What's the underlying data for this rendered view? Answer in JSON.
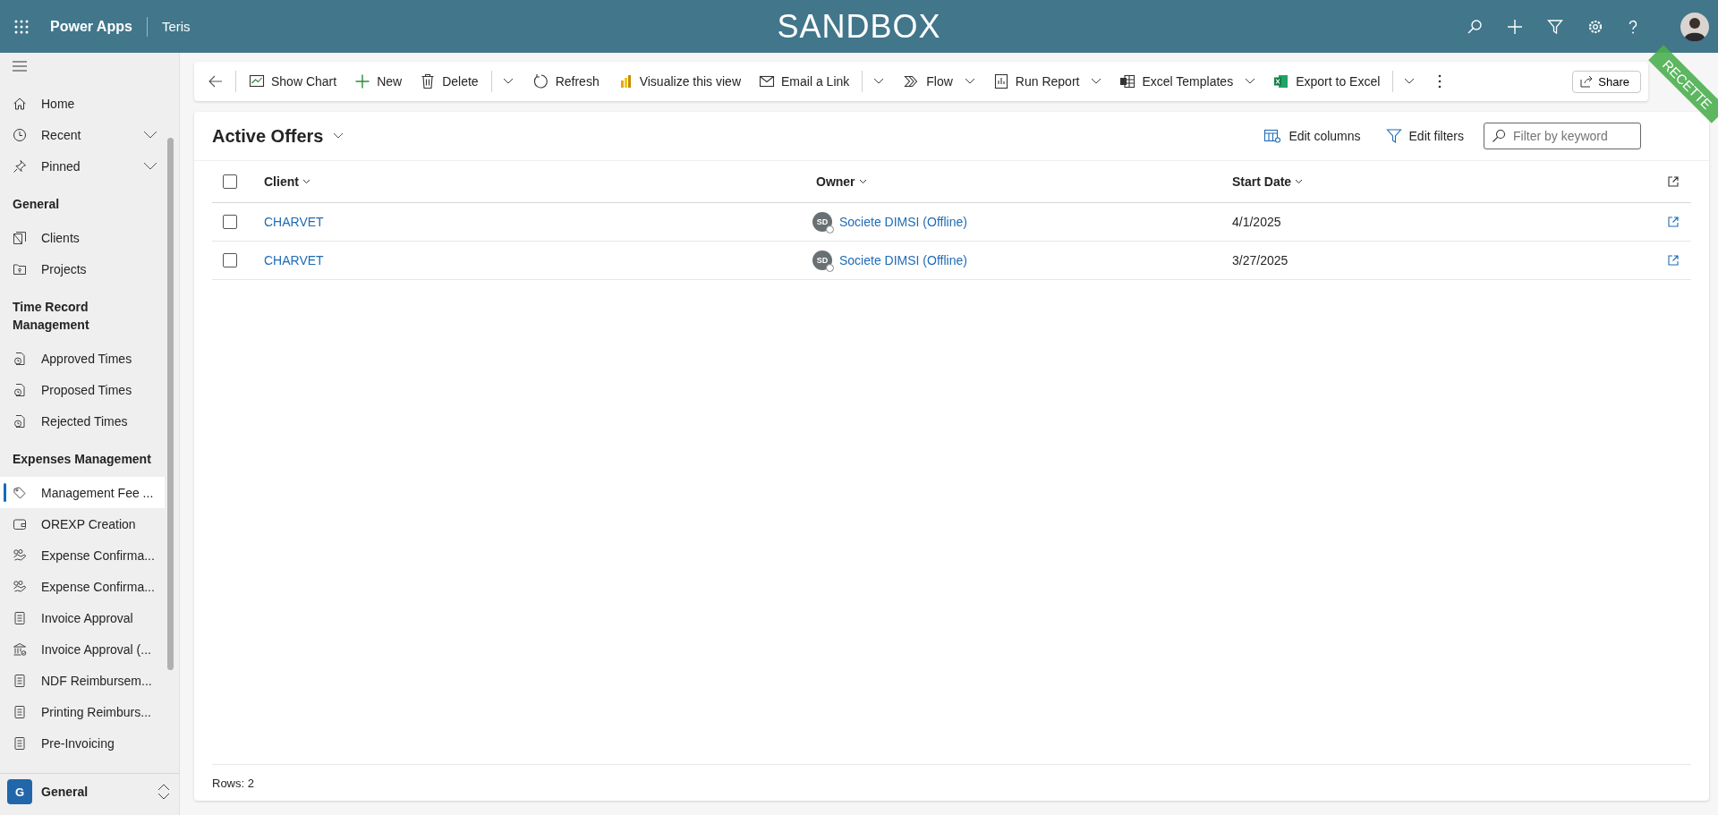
{
  "app": {
    "name": "Power Apps",
    "environment": "Teris",
    "banner": "SANDBOX",
    "ribbon": "RECETTE"
  },
  "sidebar": {
    "top_items": [
      {
        "label": "Home",
        "kind": "home",
        "expandable": false
      },
      {
        "label": "Recent",
        "kind": "clock",
        "expandable": true
      },
      {
        "label": "Pinned",
        "kind": "pin",
        "expandable": true
      }
    ],
    "groups": [
      {
        "title": "General",
        "items": [
          {
            "label": "Clients",
            "kind": "folders",
            "selected": false
          },
          {
            "label": "Projects",
            "kind": "folder",
            "selected": false
          }
        ]
      },
      {
        "title": "Time Record Management",
        "items": [
          {
            "label": "Approved Times",
            "kind": "timedoc",
            "selected": false
          },
          {
            "label": "Proposed Times",
            "kind": "timedoc",
            "selected": false
          },
          {
            "label": "Rejected Times",
            "kind": "timedoc",
            "selected": false
          }
        ]
      },
      {
        "title": "Expenses Management",
        "items": [
          {
            "label": "Management Fee ...",
            "kind": "tag",
            "selected": true
          },
          {
            "label": "OREXP Creation",
            "kind": "wallet",
            "selected": false
          },
          {
            "label": "Expense Confirma...",
            "kind": "hands",
            "selected": false
          },
          {
            "label": "Expense Confirma...",
            "kind": "hands",
            "selected": false
          },
          {
            "label": "Invoice Approval",
            "kind": "doc",
            "selected": false
          },
          {
            "label": "Invoice Approval (...",
            "kind": "bank",
            "selected": false
          },
          {
            "label": "NDF Reimbursem...",
            "kind": "doc",
            "selected": false
          },
          {
            "label": "Printing Reimburs...",
            "kind": "doc",
            "selected": false
          },
          {
            "label": "Pre-Invoicing",
            "kind": "doc",
            "selected": false
          }
        ]
      }
    ],
    "area": {
      "initial": "G",
      "label": "General"
    }
  },
  "toolbar": {
    "items": [
      {
        "label": "Show Chart",
        "kind": "plain"
      },
      {
        "label": "New",
        "kind": "plain"
      },
      {
        "label": "Delete",
        "kind": "split"
      },
      {
        "label": "Refresh",
        "kind": "plain"
      },
      {
        "label": "Visualize this view",
        "kind": "plain"
      },
      {
        "label": "Email a Link",
        "kind": "split"
      },
      {
        "label": "Flow",
        "kind": "menu"
      },
      {
        "label": "Run Report",
        "kind": "menu"
      },
      {
        "label": "Excel Templates",
        "kind": "menu"
      },
      {
        "label": "Export to Excel",
        "kind": "split"
      }
    ],
    "share": "Share"
  },
  "view": {
    "title": "Active Offers",
    "edit_columns": "Edit columns",
    "edit_filters": "Edit filters",
    "filter": {
      "placeholder": "Filter by keyword"
    }
  },
  "table": {
    "all_selected": false,
    "columns": [
      {
        "label": "Client"
      },
      {
        "label": "Owner"
      },
      {
        "label": "Start Date"
      }
    ],
    "rows": [
      {
        "client": "CHARVET",
        "owner_initials": "SD",
        "owner": "Societe DIMSI (Offline)",
        "start_date": "4/1/2025",
        "selected": false
      },
      {
        "client": "CHARVET",
        "owner_initials": "SD",
        "owner": "Societe DIMSI (Offline)",
        "start_date": "3/27/2025",
        "selected": false
      }
    ]
  },
  "footer": {
    "rows_label": "Rows: 2"
  }
}
